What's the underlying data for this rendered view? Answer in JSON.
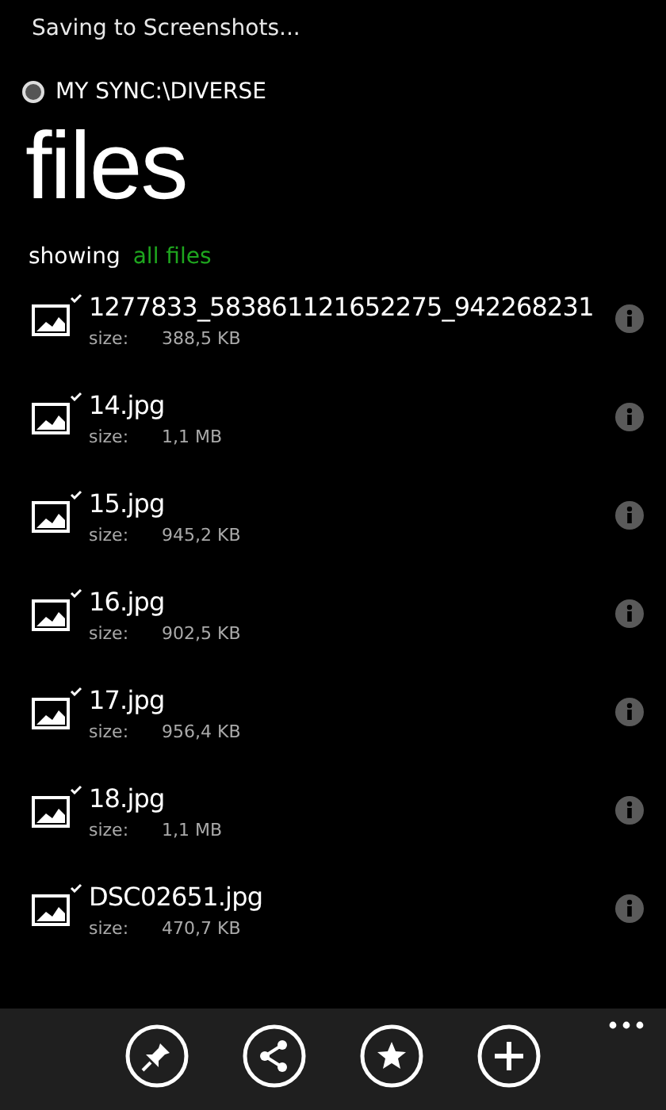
{
  "status": "Saving to Screenshots...",
  "breadcrumb": "MY SYNC:\\DIVERSE",
  "title": "files",
  "filter": {
    "label": "showing",
    "value": "all files"
  },
  "files": [
    {
      "name": "1277833_583861121652275_942268231",
      "size_label": "size:",
      "size": "388,5 KB",
      "synced": true
    },
    {
      "name": "14.jpg",
      "size_label": "size:",
      "size": "1,1 MB",
      "synced": true
    },
    {
      "name": "15.jpg",
      "size_label": "size:",
      "size": "945,2 KB",
      "synced": true
    },
    {
      "name": "16.jpg",
      "size_label": "size:",
      "size": "902,5 KB",
      "synced": true
    },
    {
      "name": "17.jpg",
      "size_label": "size:",
      "size": "956,4 KB",
      "synced": true
    },
    {
      "name": "18.jpg",
      "size_label": "size:",
      "size": "1,1 MB",
      "synced": true
    },
    {
      "name": "DSC02651.jpg",
      "size_label": "size:",
      "size": "470,7 KB",
      "synced": true
    }
  ],
  "app_bar": {
    "buttons": [
      {
        "kind": "pin"
      },
      {
        "kind": "share"
      },
      {
        "kind": "favorite"
      },
      {
        "kind": "add"
      }
    ],
    "more": true
  }
}
